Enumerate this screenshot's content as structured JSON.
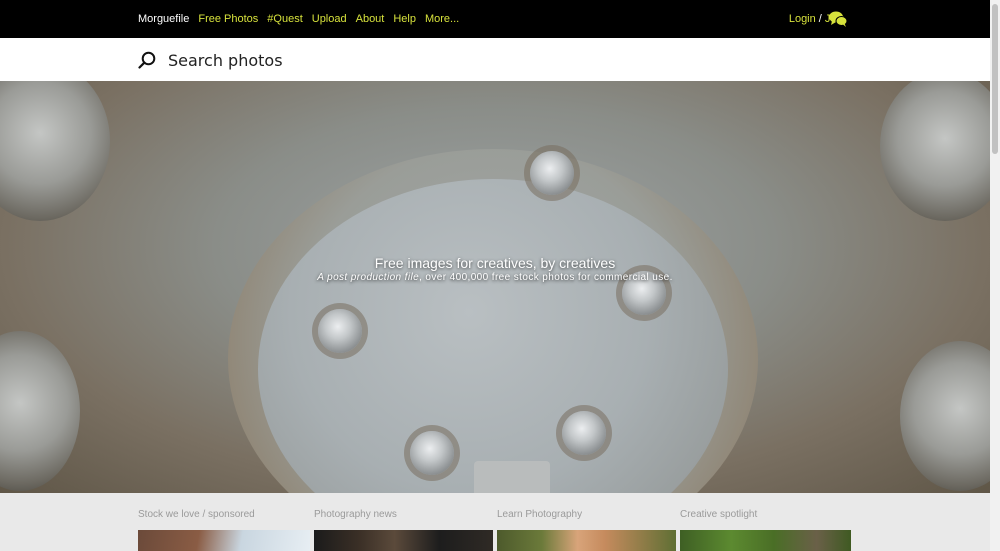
{
  "nav": {
    "brand": "Morguefile",
    "links": [
      "Free Photos",
      "#Quest",
      "Upload",
      "About",
      "Help",
      "More..."
    ],
    "login": "Login",
    "separator": "/",
    "join": "Join",
    "accent_color": "#d7e23c",
    "chat_icon": "chat-bubbles-icon"
  },
  "search": {
    "placeholder": "Search photos",
    "icon": "search-icon"
  },
  "hero": {
    "title": "Free images for creatives, by creatives",
    "subtitle_em": "A post production file",
    "subtitle_rest": ", over 400,000 free stock photos for commercial use."
  },
  "sections": [
    {
      "label": "Stock we love / sponsored"
    },
    {
      "label": "Photography news"
    },
    {
      "label": "Learn Photography"
    },
    {
      "label": "Creative spotlight"
    }
  ]
}
